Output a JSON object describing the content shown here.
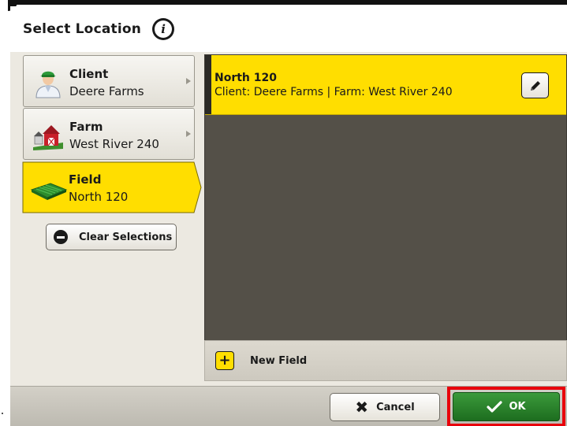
{
  "header": {
    "title": "Select Location",
    "info_icon": "info-icon"
  },
  "nav": {
    "client": {
      "title": "Client",
      "value": "Deere Farms",
      "icon": "client-person-icon"
    },
    "farm": {
      "title": "Farm",
      "value": "West River 240",
      "icon": "farm-barn-icon"
    },
    "field": {
      "title": "Field",
      "value": "North 120",
      "icon": "field-icon",
      "selected": true
    }
  },
  "clear_selections": {
    "label": "Clear Selections",
    "icon": "minus-circle-icon"
  },
  "field_list": {
    "items": [
      {
        "name": "North 120",
        "details": "Client: Deere Farms | Farm: West River 240",
        "selected": true,
        "edit_icon": "pencil-icon"
      }
    ],
    "new_field_label": "New Field",
    "new_field_icon": "plus-icon"
  },
  "footer": {
    "cancel_label": "Cancel",
    "cancel_icon": "x-icon",
    "ok_label": "OK",
    "ok_icon": "checkmark-icon"
  },
  "colors": {
    "accent_yellow": "#ffde00",
    "ok_green": "#2a8a2c",
    "highlight_red": "#e8000b",
    "list_background": "#545048"
  }
}
